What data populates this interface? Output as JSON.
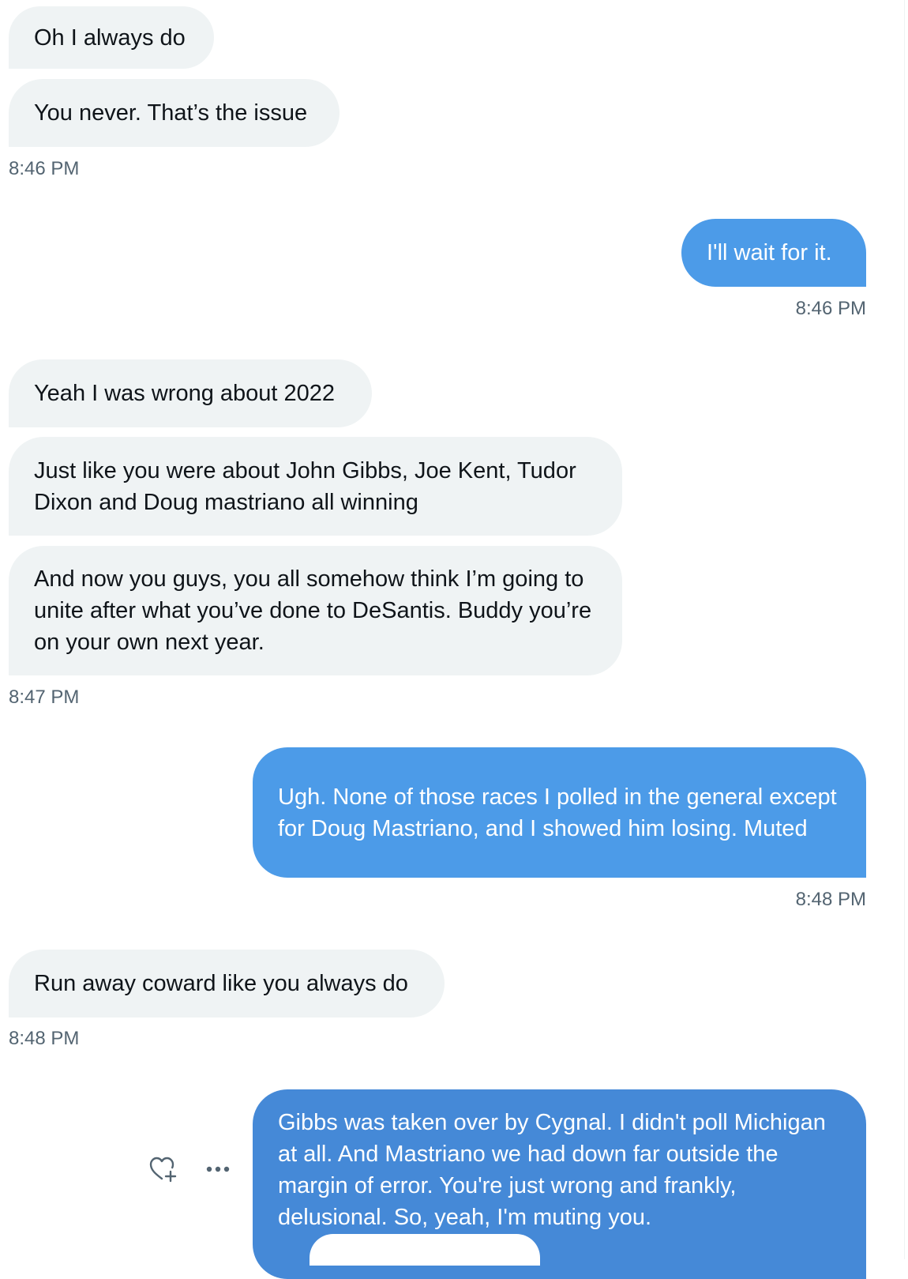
{
  "conversation": {
    "messages": [
      {
        "text": "Oh I always do"
      },
      {
        "text": "You never. That’s the issue"
      },
      {
        "text": "I'll wait for it."
      },
      {
        "text": "Yeah I was wrong about 2022"
      },
      {
        "text": "Just like you were about John Gibbs, Joe Kent, Tudor Dixon and Doug mastriano all winning"
      },
      {
        "text": "And now you guys, you all somehow think I’m going to unite after what you’ve done to DeSantis. Buddy you’re on your own next year."
      },
      {
        "text": "Ugh. None of those races I polled in the general except for Doug Mastriano, and I showed him losing. Muted"
      },
      {
        "text": "Run away coward like you always do"
      },
      {
        "text": "Gibbs was taken over by Cygnal. I didn't poll Michigan at all. And Mastriano we had down far outside the margin of error. You're just wrong and frankly, delusional. So, yeah, I'm muting you."
      }
    ],
    "timestamps": [
      "8:46 PM",
      "8:46 PM",
      "8:47 PM",
      "8:48 PM",
      "8:48 PM"
    ]
  },
  "actions": {
    "react_icon": "heart-plus-icon",
    "more_icon": "more-horizontal-icon"
  },
  "colors": {
    "incoming_bubble": "#eff3f4",
    "outgoing_bubble": "#4c9be8",
    "outgoing_bubble_hover": "#4589d7",
    "timestamp": "#536471"
  }
}
